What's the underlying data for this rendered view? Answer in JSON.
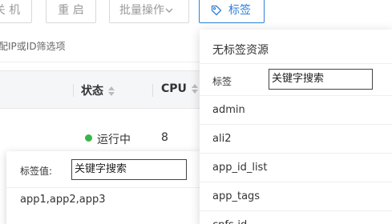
{
  "toolbar": {
    "shutdown_label": "关 机",
    "restart_label": "重 启",
    "batch_label": "批量操作",
    "batch_chevron": "chevron-down-icon",
    "tag_label": "标签",
    "tag_icon": "tag-icon",
    "accent_color": "#2f7fd8"
  },
  "search": {
    "hint": "配IP或ID筛选项"
  },
  "table": {
    "headers": {
      "status": "状态",
      "cpu": "CPU"
    },
    "rows": [
      {
        "status": "运行中",
        "status_color": "#39b54a",
        "cpu": "8"
      }
    ]
  },
  "tag_value_popover": {
    "label": "标签值:",
    "input_value": "关键字搜索",
    "value": "app1,app2,app3"
  },
  "tag_dropdown": {
    "no_tag_label": "无标签资源",
    "filter_label": "标签",
    "filter_value": "关键字搜索",
    "options": [
      "admin",
      "ali2",
      "app_id_list",
      "app_tags",
      "cnfs-id"
    ]
  }
}
